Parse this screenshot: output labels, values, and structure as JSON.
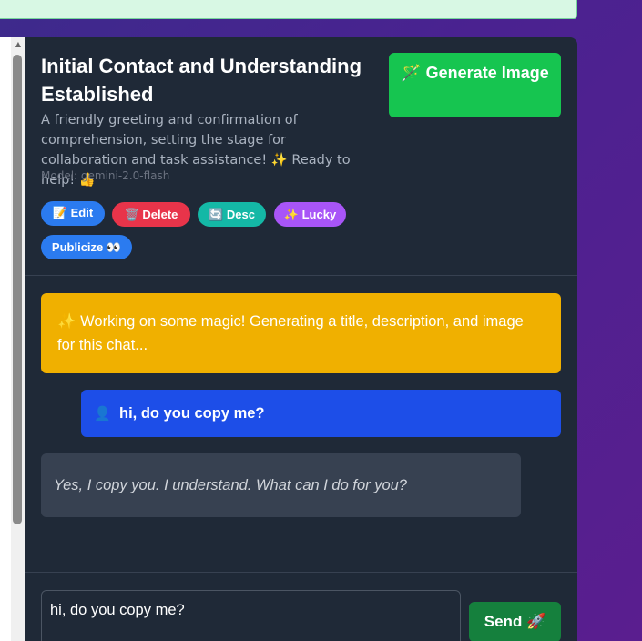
{
  "banner": {
    "text": ""
  },
  "header": {
    "title": "Initial Contact and Understanding Established",
    "description": "A friendly greeting and confirmation of comprehension, setting the stage for collaboration and task assistance! ✨ Ready to help! 👍",
    "model": "Model: gemini-2.0-flash",
    "generate_label": "🪄 Generate Image"
  },
  "actions": {
    "edit": "📝 Edit",
    "delete": "🗑️ Delete",
    "desc": "🔄 Desc",
    "lucky": "✨ Lucky",
    "publicize": "Publicize 👀"
  },
  "messages": {
    "notice": "✨ Working on some magic! Generating a title, description, and image for this chat...",
    "user_icon": "👤",
    "user_text": "hi, do you copy me?",
    "ai_text": "Yes, I copy you. I understand. What can I do for you?"
  },
  "composer": {
    "value": "hi, do you copy me?",
    "send_label": "Send 🚀"
  },
  "colors": {
    "generate": "#16c550",
    "notice": "#f0b000",
    "user_bubble": "#1d4ee8",
    "send": "#15803d"
  }
}
